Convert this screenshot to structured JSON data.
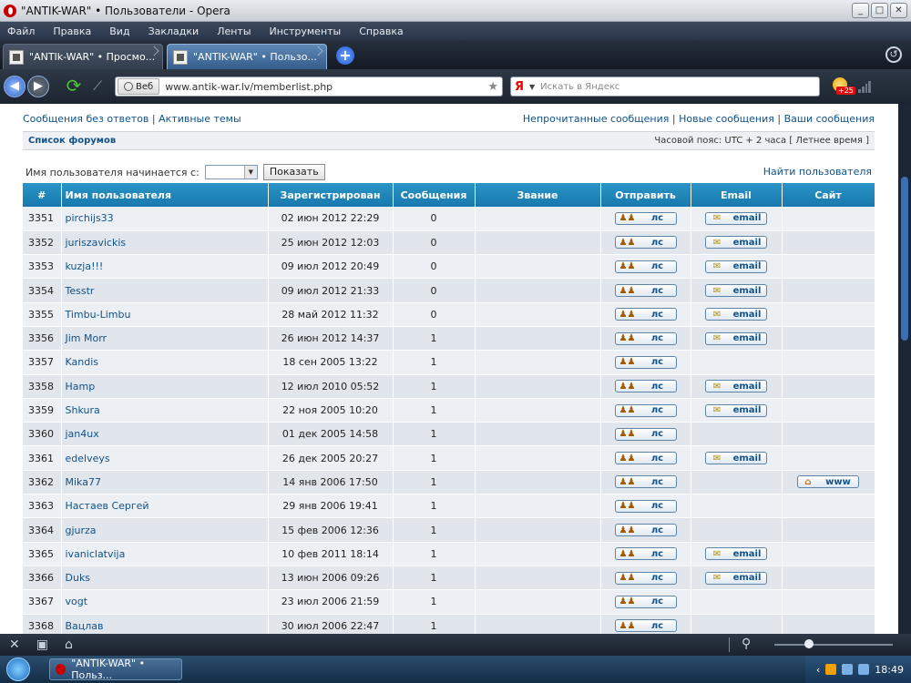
{
  "window": {
    "title": "\"ANTIK-WAR\" • Пользователи - Opera"
  },
  "menu": [
    "Файл",
    "Правка",
    "Вид",
    "Закладки",
    "Ленты",
    "Инструменты",
    "Справка"
  ],
  "tabs": [
    {
      "label": "\"ANTIk-WAR\" • Просмо...",
      "active": false
    },
    {
      "label": "\"ANTIK-WAR\" • Пользо...",
      "active": true
    }
  ],
  "address": {
    "web_label": "Веб",
    "url": "www.antik-war.lv/memberlist.php",
    "search_placeholder": "Искать в Яндекс",
    "search_logo": "Я",
    "speed_dial_badge": "+25"
  },
  "page": {
    "top_left_links": [
      "Сообщения без ответов",
      "Активные темы"
    ],
    "top_right_links": [
      "Непрочитанные сообщения",
      "Новые сообщения",
      "Ваши сообщения"
    ],
    "separator": "|",
    "forum_list": "Список форумов",
    "timezone": "Часовой пояс: UTC + 2 часа [ Летнее время ]",
    "filter_label": "Имя пользователя начинается с:",
    "show_button": "Показать",
    "find_user": "Найти пользователя"
  },
  "table": {
    "headers": [
      "#",
      "Имя пользователя",
      "Зарегистрирован",
      "Сообщения",
      "Звание",
      "Отправить",
      "Email",
      "Сайт"
    ],
    "pm_label": "лс",
    "email_label": "email",
    "www_label": "www",
    "rows": [
      {
        "num": "3351",
        "name": "pirchijs33",
        "date": "02 июн 2012 22:29",
        "posts": "0",
        "email": true,
        "www": false
      },
      {
        "num": "3352",
        "name": "juriszavickis",
        "date": "25 июн 2012 12:03",
        "posts": "0",
        "email": true,
        "www": false
      },
      {
        "num": "3353",
        "name": "kuzja!!!",
        "date": "09 июл 2012 20:49",
        "posts": "0",
        "email": true,
        "www": false
      },
      {
        "num": "3354",
        "name": "Tesstr",
        "date": "09 июл 2012 21:33",
        "posts": "0",
        "email": true,
        "www": false
      },
      {
        "num": "3355",
        "name": "Timbu-Limbu",
        "date": "28 май 2012 11:32",
        "posts": "0",
        "email": true,
        "www": false
      },
      {
        "num": "3356",
        "name": "Jim Morr",
        "date": "26 июн 2012 14:37",
        "posts": "1",
        "email": true,
        "www": false
      },
      {
        "num": "3357",
        "name": "Kandis",
        "date": "18 сен 2005 13:22",
        "posts": "1",
        "email": false,
        "www": false
      },
      {
        "num": "3358",
        "name": "Hamp",
        "date": "12 июл 2010 05:52",
        "posts": "1",
        "email": true,
        "www": false
      },
      {
        "num": "3359",
        "name": "Shkura",
        "date": "22 ноя 2005 10:20",
        "posts": "1",
        "email": true,
        "www": false
      },
      {
        "num": "3360",
        "name": "jan4ux",
        "date": "01 дек 2005 14:58",
        "posts": "1",
        "email": false,
        "www": false
      },
      {
        "num": "3361",
        "name": "edelveys",
        "date": "26 дек 2005 20:27",
        "posts": "1",
        "email": true,
        "www": false
      },
      {
        "num": "3362",
        "name": "Mika77",
        "date": "14 янв 2006 17:50",
        "posts": "1",
        "email": false,
        "www": true
      },
      {
        "num": "3363",
        "name": "Настаев Сергей",
        "date": "29 янв 2006 19:41",
        "posts": "1",
        "email": false,
        "www": false
      },
      {
        "num": "3364",
        "name": "gjurza",
        "date": "15 фев 2006 12:36",
        "posts": "1",
        "email": false,
        "www": false
      },
      {
        "num": "3365",
        "name": "ivaniclatvija",
        "date": "10 фев 2011 18:14",
        "posts": "1",
        "email": true,
        "www": false
      },
      {
        "num": "3366",
        "name": "Duks",
        "date": "13 июн 2006 09:26",
        "posts": "1",
        "email": true,
        "www": false
      },
      {
        "num": "3367",
        "name": "vogt",
        "date": "23 июл 2006 21:59",
        "posts": "1",
        "email": false,
        "www": false
      },
      {
        "num": "3368",
        "name": "Вацлав",
        "date": "30 июл 2006 22:47",
        "posts": "1",
        "email": false,
        "www": false
      }
    ]
  },
  "taskbar": {
    "task_label": "\"ANTIK-WAR\" • Польз...",
    "clock": "18:49"
  }
}
